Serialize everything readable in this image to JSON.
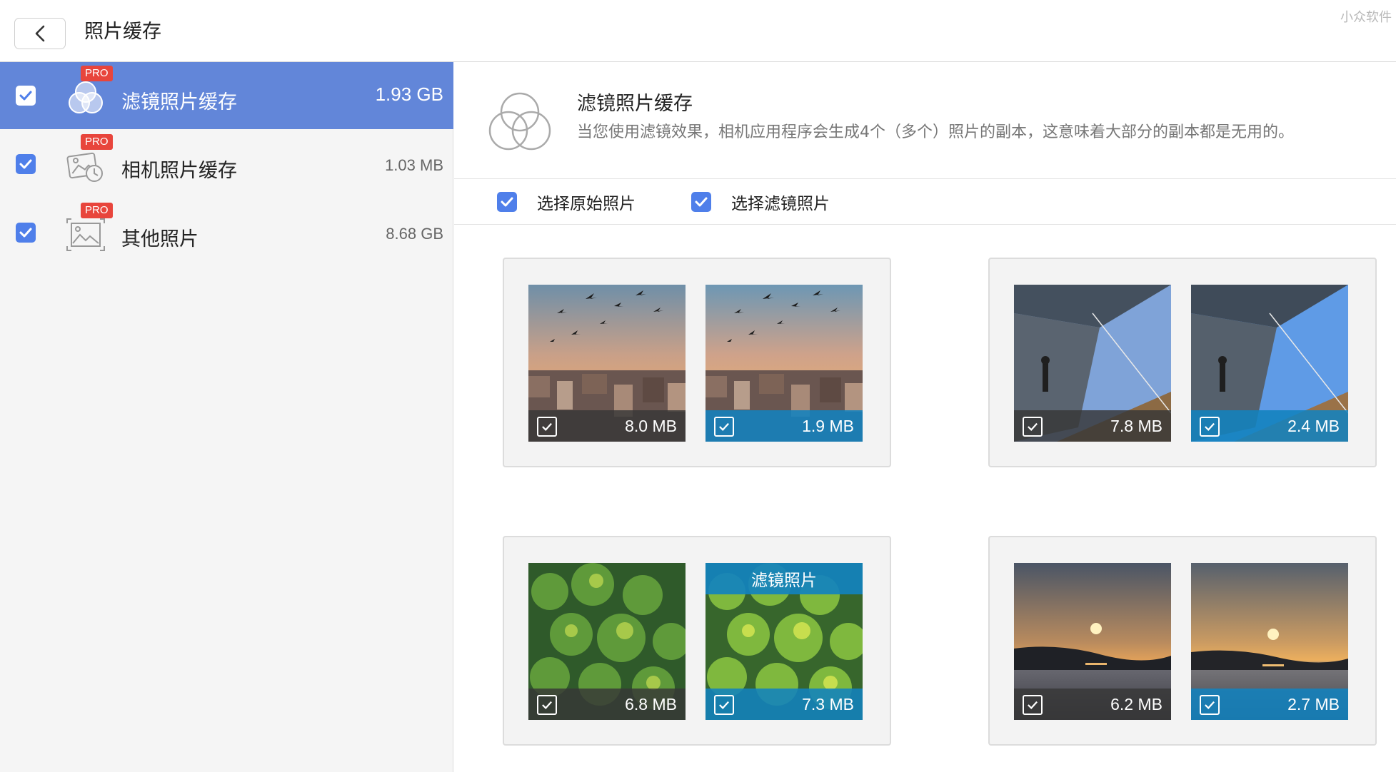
{
  "header": {
    "title": "照片缓存",
    "watermark": "小众软件"
  },
  "sidebar": {
    "items": [
      {
        "label": "滤镜照片缓存",
        "size": "1.93 GB",
        "badge": "PRO",
        "checked": true,
        "active": true,
        "icon": "filter-circles-icon"
      },
      {
        "label": "相机照片缓存",
        "size": "1.03 MB",
        "badge": "PRO",
        "checked": true,
        "active": false,
        "icon": "camera-photo-clock-icon"
      },
      {
        "label": "其他照片",
        "size": "8.68 GB",
        "badge": "PRO",
        "checked": true,
        "active": false,
        "icon": "picture-frame-icon"
      }
    ]
  },
  "main": {
    "title": "滤镜照片缓存",
    "description": "当您使用滤镜效果，相机应用程序会生成4个（多个）照片的副本，这意味着大部分的副本都是无用的。",
    "filters": [
      {
        "label": "选择原始照片",
        "checked": true
      },
      {
        "label": "选择滤镜照片",
        "checked": true
      }
    ],
    "groups": [
      {
        "original": {
          "size": "8.0 MB",
          "checked": true,
          "scene": "birds-city"
        },
        "filtered": {
          "size": "1.9 MB",
          "checked": true,
          "scene": "birds-city"
        }
      },
      {
        "original": {
          "size": "7.8 MB",
          "checked": true,
          "scene": "stadium"
        },
        "filtered": {
          "size": "2.4 MB",
          "checked": true,
          "scene": "stadium"
        }
      },
      {
        "original": {
          "size": "6.8 MB",
          "checked": true,
          "scene": "forest"
        },
        "filtered": {
          "size": "7.3 MB",
          "checked": true,
          "scene": "forest",
          "tag": "滤镜照片"
        }
      },
      {
        "original": {
          "size": "6.2 MB",
          "checked": true,
          "scene": "sunset"
        },
        "filtered": {
          "size": "2.7 MB",
          "checked": true,
          "scene": "sunset"
        }
      }
    ]
  },
  "colors": {
    "accent": "#4f7fea",
    "active_row": "#6286d9",
    "pro_badge": "#e8453c",
    "filtered_bar": "#1282be"
  }
}
